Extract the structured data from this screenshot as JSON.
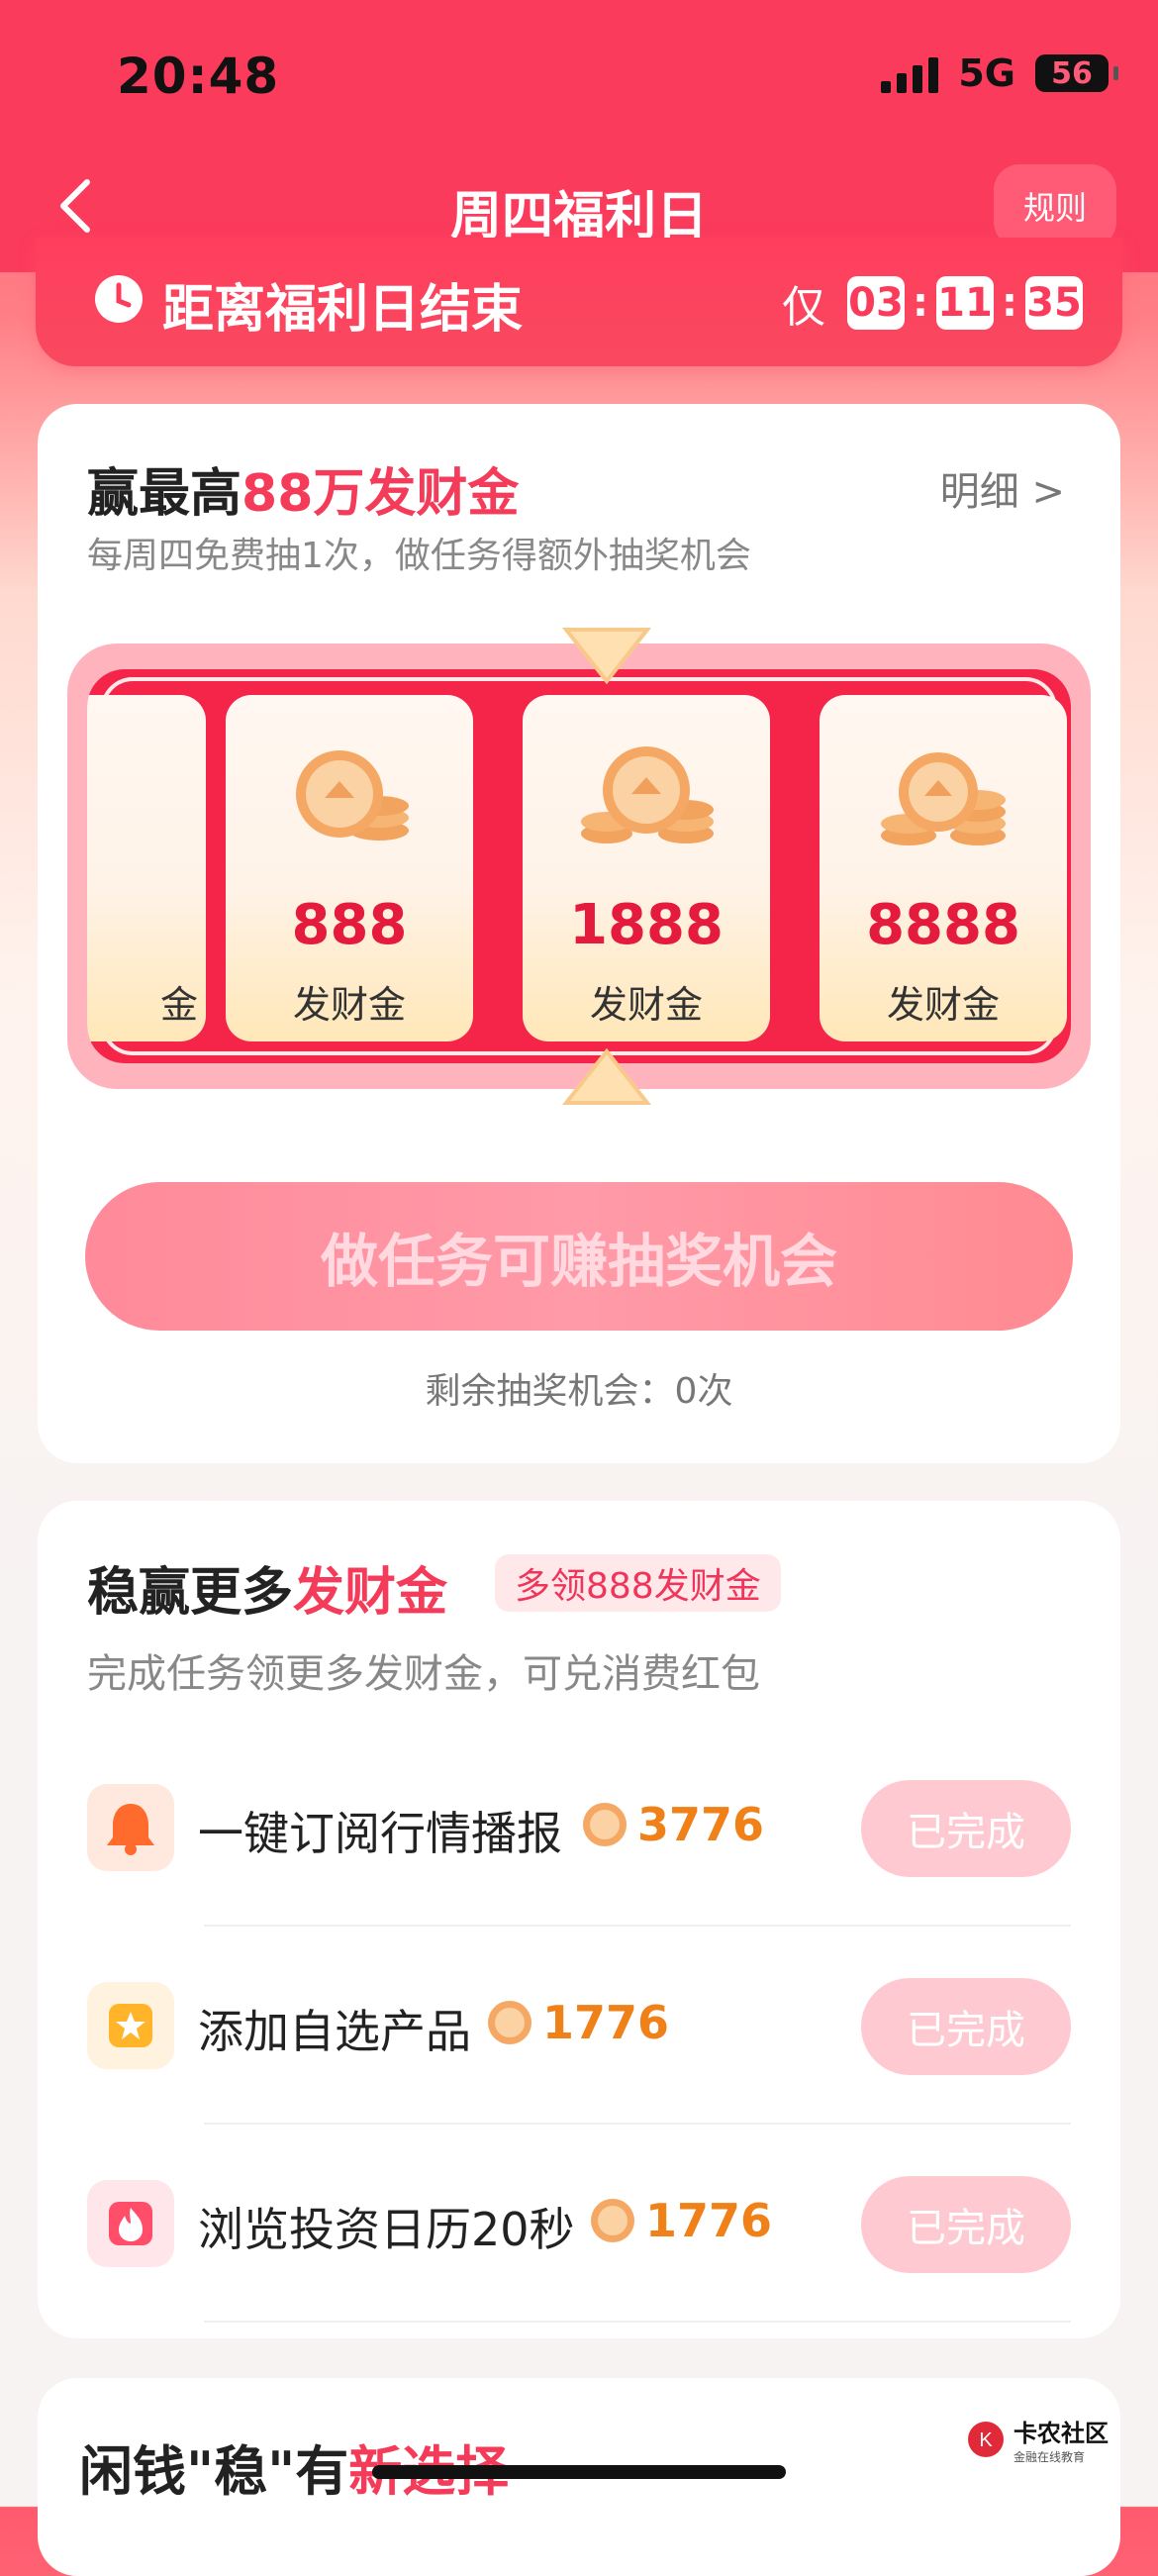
{
  "status": {
    "time": "20:48",
    "network": "5G",
    "battery": "56"
  },
  "header": {
    "title": "周四福利日",
    "rules": "规则"
  },
  "countdown": {
    "label": "距离福利日结束",
    "prefix": "仅",
    "hours": "03",
    "minutes": "11",
    "seconds": "35"
  },
  "lottery": {
    "title_prefix": "赢最高",
    "title_highlight": "88万发财金",
    "detail": "明细 >",
    "subtitle": "每周四免费抽1次，做任务得额外抽奖机会",
    "prizes": [
      {
        "value": "",
        "unit": "金"
      },
      {
        "value": "888",
        "unit": "发财金"
      },
      {
        "value": "1888",
        "unit": "发财金"
      },
      {
        "value": "8888",
        "unit": "发财金"
      }
    ],
    "button": "做任务可赚抽奖机会",
    "remaining": "剩余抽奖机会：0次"
  },
  "tasks": {
    "title_prefix": "稳赢更多",
    "title_highlight": "发财金",
    "badge": "多领888发财金",
    "subtitle": "完成任务领更多发财金，可兑消费红包",
    "items": [
      {
        "name": "一键订阅行情播报",
        "reward": "3776",
        "status": "已完成",
        "icon": "bell-icon"
      },
      {
        "name": "添加自选产品",
        "reward": "1776",
        "status": "已完成",
        "icon": "star-icon"
      },
      {
        "name": "浏览投资日历20秒",
        "reward": "1776",
        "status": "已完成",
        "icon": "fire-icon"
      }
    ]
  },
  "section3": {
    "title_prefix": "闲钱\"稳\"有",
    "title_highlight": "新选择"
  },
  "watermark": {
    "name": "卡农社区",
    "tagline": "金融在线教育"
  },
  "colors": {
    "brand": "#fb3b5c",
    "reward": "#f08018",
    "done": "#ffc9d1"
  }
}
